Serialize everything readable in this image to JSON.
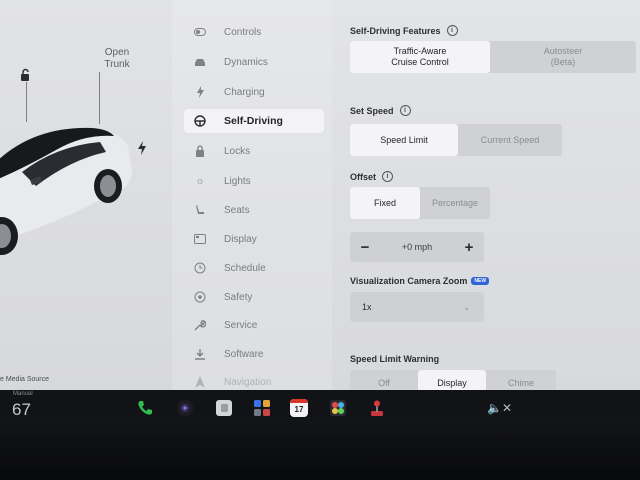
{
  "car": {
    "trunk_label_1": "Open",
    "trunk_label_2": "Trunk",
    "media_source": "e Media Source"
  },
  "nav": {
    "items": [
      {
        "label": "Controls",
        "icon": "toggle-icon"
      },
      {
        "label": "Dynamics",
        "icon": "car-icon"
      },
      {
        "label": "Charging",
        "icon": "bolt-icon"
      },
      {
        "label": "Self-Driving",
        "icon": "steering-wheel-icon",
        "active": true
      },
      {
        "label": "Locks",
        "icon": "lock-icon"
      },
      {
        "label": "Lights",
        "icon": "sun-icon"
      },
      {
        "label": "Seats",
        "icon": "seat-icon"
      },
      {
        "label": "Display",
        "icon": "display-icon"
      },
      {
        "label": "Schedule",
        "icon": "clock-icon"
      },
      {
        "label": "Safety",
        "icon": "safety-icon"
      },
      {
        "label": "Service",
        "icon": "wrench-icon"
      },
      {
        "label": "Software",
        "icon": "download-icon"
      },
      {
        "label": "Navigation",
        "icon": "navigation-icon"
      }
    ]
  },
  "settings": {
    "self_driving_title": "Self-Driving Features",
    "sd_opt1_line1": "Traffic-Aware",
    "sd_opt1_line2": "Cruise Control",
    "sd_opt2_line1": "Autosteer",
    "sd_opt2_line2": "(Beta)",
    "set_speed_title": "Set Speed",
    "speed_limit": "Speed Limit",
    "current_speed": "Current Speed",
    "offset_title": "Offset",
    "fixed": "Fixed",
    "percentage": "Percentage",
    "stepper_minus": "−",
    "stepper_value": "+0 mph",
    "stepper_plus": "+",
    "zoom_title": "Visualization Camera Zoom",
    "new_badge": "NEW",
    "zoom_value": "1x",
    "warning_title": "Speed Limit Warning",
    "warn_off": "Off",
    "warn_display": "Display",
    "warn_chime": "Chime"
  },
  "taskbar": {
    "temp_label": "Manual",
    "temp_value": "67",
    "calendar_day": "17"
  },
  "colors": {
    "accent": "#2f63d6",
    "phone": "#2fbf4f"
  }
}
